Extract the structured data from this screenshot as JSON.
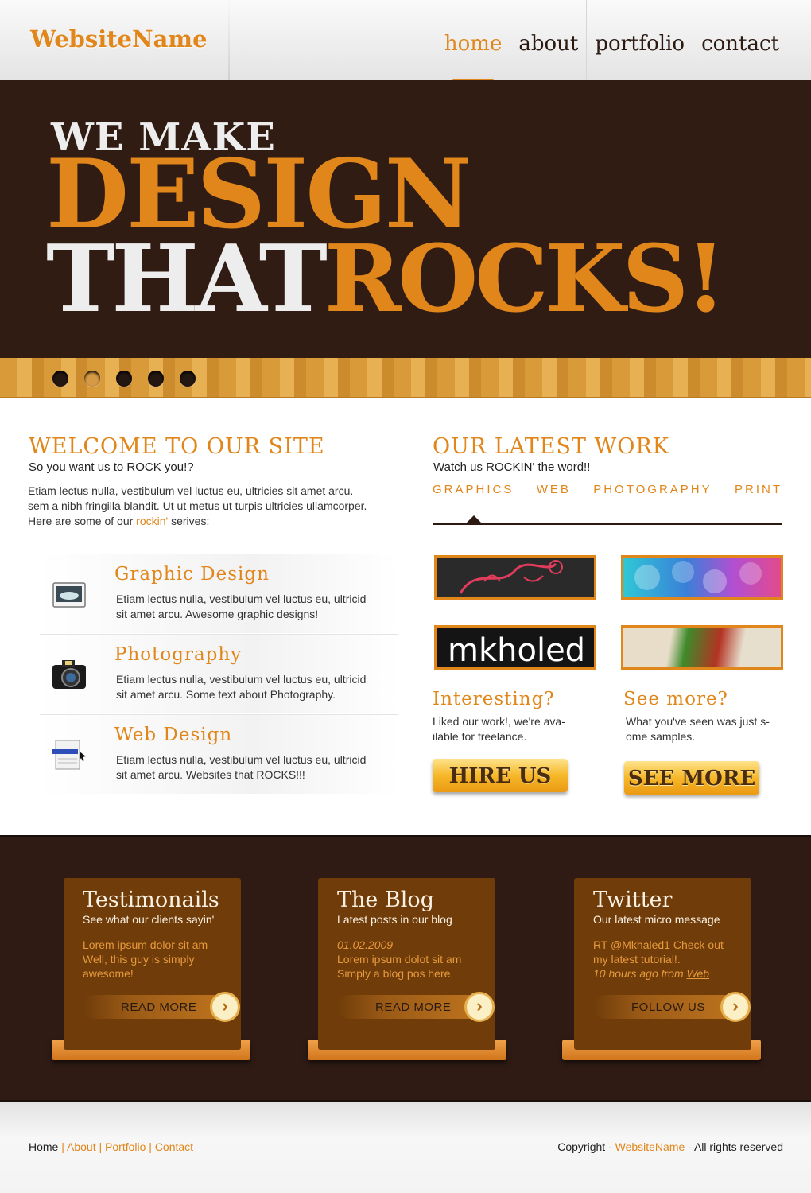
{
  "header": {
    "logo": "WebsiteName",
    "nav": [
      {
        "label": "home",
        "active": true
      },
      {
        "label": "about",
        "active": false
      },
      {
        "label": "portfolio",
        "active": false
      },
      {
        "label": "contact",
        "active": false
      }
    ]
  },
  "hero": {
    "line1": "WE MAKE",
    "line2": "DESIGN",
    "line3_white": "THAT",
    "line3_orange": "ROCKS!",
    "slider_dots": 5,
    "active_dot": 2
  },
  "welcome": {
    "title": "WELCOME TO OUR SITE",
    "subtitle": "So you want us to ROCK you!?",
    "para_line1": "Etiam lectus nulla, vestibulum vel luctus eu, ultricies sit amet arcu.",
    "para_line2": "sem a nibh fringilla blandit. Ut ut metus ut turpis ultricies ullamcorper.",
    "para_line3_pre": "Here are some of our ",
    "para_line3_link": "rockin'",
    "para_line3_post": " serives:"
  },
  "services": [
    {
      "title": "Graphic Design",
      "text_line1": "Etiam lectus nulla, vestibulum vel luctus eu, ultricid",
      "text_line2": "sit amet arcu. Awesome graphic designs!",
      "icon": "monitor-icon"
    },
    {
      "title": "Photography",
      "text_line1": "Etiam lectus nulla, vestibulum vel luctus eu, ultricid",
      "text_line2": "sit amet arcu. Some text about Photography.",
      "icon": "camera-icon"
    },
    {
      "title": "Web Design",
      "text_line1": "Etiam lectus nulla, vestibulum vel luctus eu, ultricid",
      "text_line2": "sit amet arcu. Websites that ROCKS!!!",
      "icon": "webpage-icon"
    }
  ],
  "work": {
    "title": "OUR LATEST WORK",
    "subtitle": "Watch us ROCKIN' the word!!",
    "tabs": [
      "GRAPHICS",
      "WEB",
      "PHOTOGRAPHY",
      "PRINT"
    ],
    "thumb3_text": "mkholed"
  },
  "cta": [
    {
      "title": "Interesting?",
      "text_line1": "Liked our work!, we're ava-",
      "text_line2": "ilable for freelance.",
      "button": "HIRE US"
    },
    {
      "title": "See more?",
      "text_line1": "What you've seen was just s-",
      "text_line2": "ome samples.",
      "button": "SEE MORE"
    }
  ],
  "boxes": [
    {
      "title": "Testimonails",
      "subtitle": "See what our clients sayin'",
      "line1": "Lorem ipsum dolor sit am",
      "line2": "Well, this guy is simply",
      "line3": "awesome!",
      "button": "READ MORE"
    },
    {
      "title": "The Blog",
      "subtitle": "Latest posts in our blog",
      "line1": "01.02.2009",
      "line2": "Lorem ipsum dolot sit am",
      "line3": "Simply a blog pos here.",
      "button": "READ MORE"
    },
    {
      "title": "Twitter",
      "subtitle": "Our latest micro message",
      "line1": "RT @Mkhaled1 Check out",
      "line2": "my latest tutorial!.",
      "line3_pre": "10 hours ago from ",
      "line3_link": "Web",
      "button": "FOLLOW US"
    }
  ],
  "footer": {
    "links": [
      "Home",
      "About",
      "Portfolio",
      "Contact"
    ],
    "separator": "|",
    "copy_pre": "Copyright - ",
    "copy_link": "WebsiteName",
    "copy_post": " - All rights reserved"
  },
  "colors": {
    "accent": "#e0861a",
    "dark": "#311c14",
    "box": "#6f3c0a"
  }
}
